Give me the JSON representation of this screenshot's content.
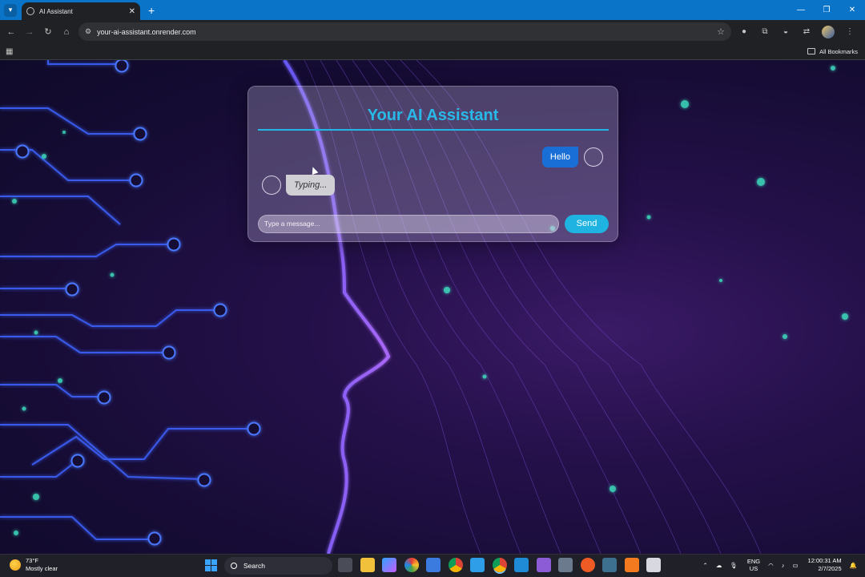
{
  "browser": {
    "tab_title": "AI Assistant",
    "url": "your-ai-assistant.onrender.com",
    "bookmarks_label": "All Bookmarks"
  },
  "chat": {
    "title": "Your AI Assistant",
    "user_message": "Hello",
    "bot_message": "Typing...",
    "input_placeholder": "Type a message...",
    "send_label": "Send"
  },
  "taskbar": {
    "temperature": "73°F",
    "weather": "Mostly clear",
    "search_label": "Search",
    "lang_line1": "ENG",
    "lang_line2": "US",
    "time": "12:00:31 AM",
    "date": "2/7/2025"
  },
  "icons": [
    "tab-list-icon",
    "favicon-icon",
    "close-icon",
    "new-tab-icon",
    "back-icon",
    "forward-icon",
    "reload-icon",
    "home-icon",
    "site-info-icon",
    "star-icon",
    "mic-icon",
    "extensions-icon",
    "incognito-icon",
    "translate-icon",
    "profile-icon",
    "menu-icon",
    "apps-icon",
    "folder-icon",
    "windows-start-icon",
    "search-icon",
    "wifi-icon",
    "volume-icon",
    "battery-icon",
    "notification-icon"
  ],
  "colors": {
    "accent": "#1fb3e2",
    "title": "#29b9e8",
    "user_bubble": "#1a6fd6",
    "bot_bubble": "#cfcfd4",
    "tab_bar": "#0a74c9"
  }
}
